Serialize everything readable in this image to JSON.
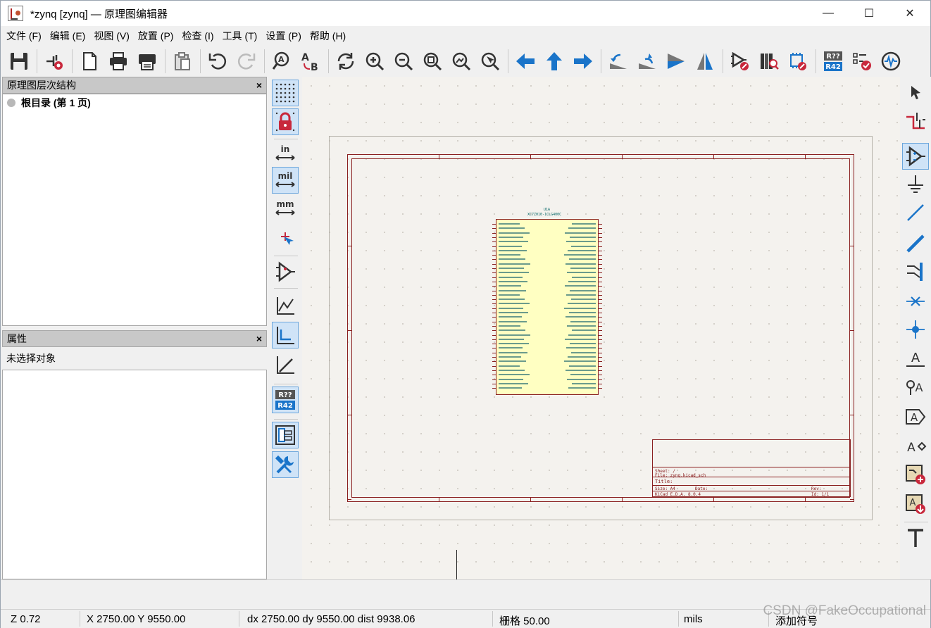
{
  "window": {
    "title": "*zynq [zynq] — 原理图编辑器",
    "minimize": "—",
    "maximize": "☐",
    "close": "✕"
  },
  "menu": [
    "文件 (F)",
    "编辑 (E)",
    "视图 (V)",
    "放置 (P)",
    "检查 (I)",
    "工具 (T)",
    "设置 (P)",
    "帮助 (H)"
  ],
  "hierarchy_panel": {
    "title": "原理图层次结构",
    "close": "×",
    "root": "根目录 (第 1 页)"
  },
  "properties_panel": {
    "title": "属性",
    "close": "×",
    "empty": "未选择对象"
  },
  "left_toolbar": {
    "unit_in": "in",
    "unit_mil": "mil",
    "unit_mm": "mm",
    "annotate_top": "R??",
    "annotate_bottom": "R42"
  },
  "top_toolbar": {
    "annotate_top": "R??",
    "annotate_bottom": "R42"
  },
  "schematic": {
    "ref": "U1A",
    "value": "XC7Z010-1CLG400C",
    "title_block": {
      "sheet": "Sheet: /",
      "file": "File: zynq.kicad_sch",
      "title": "Title:",
      "size": "Size: A4",
      "date": "Date:",
      "rev": "Rev:",
      "kicad": "KiCad E.D.A. 8.0.4",
      "id": "Id: 1/1"
    }
  },
  "status": {
    "zoom": "Z 0.72",
    "xy": "X 2750.00  Y 9550.00",
    "delta": "dx 2750.00  dy 9550.00  dist 9938.06",
    "grid": "栅格 50.00",
    "units": "mils",
    "mode": "添加符号"
  },
  "watermark": "CSDN @FakeOccupational",
  "colors": {
    "frame": "#8a2020",
    "component_fill": "#ffffc2",
    "canvas_bg": "#f4f2ee",
    "active_tool_bg": "#cfe3f7",
    "icon_blue": "#1a74c9",
    "icon_red": "#c8283c"
  }
}
